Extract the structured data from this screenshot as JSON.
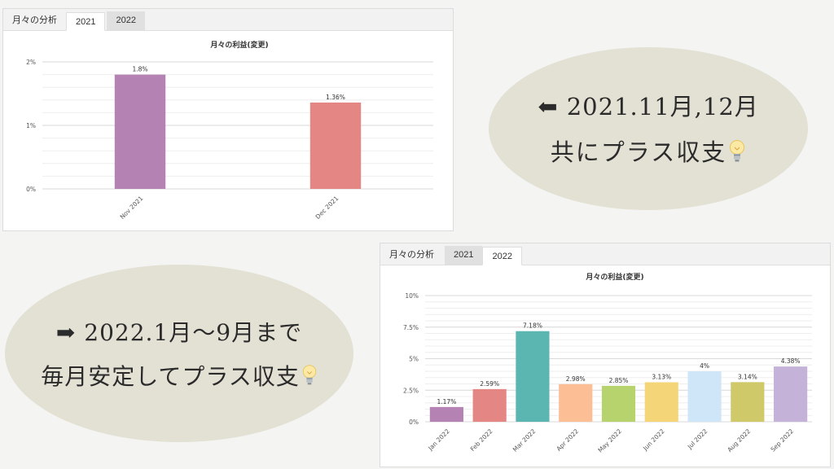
{
  "panel_2021": {
    "tabs": [
      {
        "label": "月々の分析",
        "state": "plain"
      },
      {
        "label": "2021",
        "state": "active"
      },
      {
        "label": "2022",
        "state": "inactive"
      }
    ],
    "chart_data": {
      "type": "bar",
      "title": "月々の利益(変更)",
      "categories": [
        "Nov 2021",
        "Dec 2021"
      ],
      "values": [
        1.8,
        1.36
      ],
      "value_labels": [
        "1.8%",
        "1.36%"
      ],
      "colors": [
        "#b483b3",
        "#e48683"
      ],
      "ylim": [
        0,
        2
      ],
      "yticks": [
        0,
        1,
        2
      ],
      "ytick_labels": [
        "0%",
        "1%",
        "2%"
      ],
      "grid": true,
      "xlabel": "",
      "ylabel": ""
    }
  },
  "panel_2022": {
    "tabs": [
      {
        "label": "月々の分析",
        "state": "plain"
      },
      {
        "label": "2021",
        "state": "inactive"
      },
      {
        "label": "2022",
        "state": "active"
      }
    ],
    "chart_data": {
      "type": "bar",
      "title": "月々の利益(変更)",
      "categories": [
        "Jan 2022",
        "Feb 2022",
        "Mar 2022",
        "Apr 2022",
        "May 2022",
        "Jun 2022",
        "Jul 2022",
        "Aug 2022",
        "Sep 2022"
      ],
      "values": [
        1.17,
        2.59,
        7.18,
        2.98,
        2.85,
        3.13,
        4,
        3.14,
        4.38
      ],
      "value_labels": [
        "1.17%",
        "2.59%",
        "7.18%",
        "2.98%",
        "2.85%",
        "3.13%",
        "4%",
        "3.14%",
        "4.38%"
      ],
      "colors": [
        "#b483b3",
        "#e48683",
        "#5bb6b2",
        "#fcbe95",
        "#b6d36e",
        "#f4d679",
        "#cfe6f8",
        "#cfc96a",
        "#c4b2d8"
      ],
      "ylim": [
        0,
        10
      ],
      "yticks": [
        0,
        2.5,
        5,
        7.5,
        10
      ],
      "ytick_labels": [
        "0%",
        "2.5%",
        "5%",
        "7.5%",
        "10%"
      ],
      "grid": true,
      "xlabel": "",
      "ylabel": ""
    }
  },
  "bubble_top": {
    "line1": "⬅ 2021.11月,12月",
    "line2": "共にプラス収支",
    "icon": "light-bulb-icon"
  },
  "bubble_bottom": {
    "line1": "➡ 2022.1月〜9月まで",
    "line2": "毎月安定してプラス収支",
    "icon": "light-bulb-icon"
  }
}
